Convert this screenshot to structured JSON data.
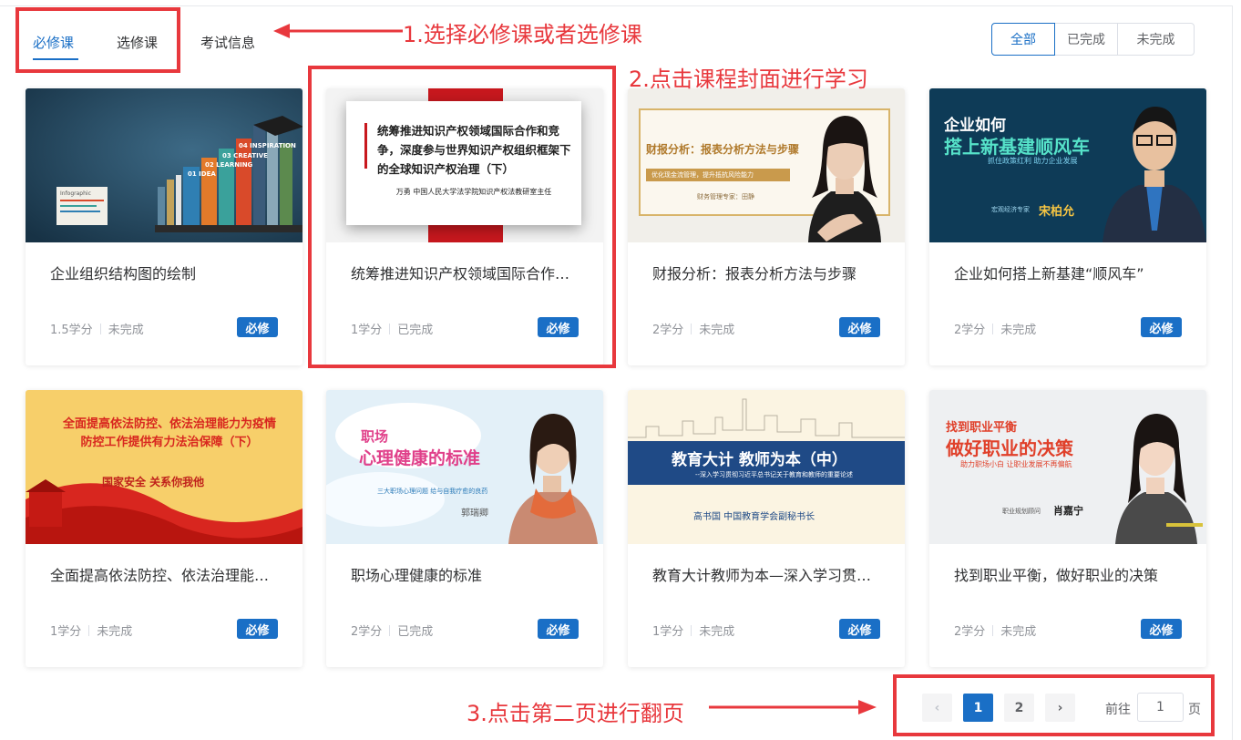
{
  "tabs": [
    {
      "label": "必修课",
      "active": true
    },
    {
      "label": "选修课",
      "active": false
    },
    {
      "label": "考试信息",
      "active": false
    }
  ],
  "filter": [
    {
      "label": "全部",
      "active": true
    },
    {
      "label": "已完成",
      "active": false
    },
    {
      "label": "未完成",
      "active": false
    }
  ],
  "courses": [
    {
      "title": "企业组织结构图的绘制",
      "credit": "1.5学分",
      "status": "未完成",
      "badge": "必修",
      "cover": {
        "book_labels": [
          "01 IDEA",
          "02 LEARNING",
          "03 CREATIVE",
          "04 INSPIRATION"
        ],
        "small_book": "Infographic"
      }
    },
    {
      "title": "统筹推进知识产权领域国际合作…",
      "credit": "1学分",
      "status": "已完成",
      "badge": "必修",
      "cover": {
        "heading": "统筹推进知识产权领域国际合作和竞争，深度参与世界知识产权组织框架下的全球知识产权治理（下）",
        "speaker": "万勇  中国人民大学法学院知识产权法教研室主任"
      }
    },
    {
      "title": "财报分析：报表分析方法与步骤",
      "credit": "2学分",
      "status": "未完成",
      "badge": "必修",
      "cover": {
        "heading": "财报分析：报表分析方法与步骤",
        "sub": "优化现金流管理，提升抵抗风险能力",
        "speaker": "财务管理专家：田静"
      }
    },
    {
      "title": "企业如何搭上新基建“顺风车”",
      "credit": "2学分",
      "status": "未完成",
      "badge": "必修",
      "cover": {
        "line1": "企业如何",
        "line2": "搭上新基建顺风车",
        "sub": "抓住政策红利  助力企业发展",
        "speaker_role": "宏观经济专家",
        "speaker": "宋柏允"
      }
    },
    {
      "title": "全面提高依法防控、依法治理能…",
      "credit": "1学分",
      "status": "未完成",
      "badge": "必修",
      "cover": {
        "heading": "全面提高依法防控、依法治理能力为疫情防控工作提供有力法治保障（下）",
        "sub": "国家安全 关系你我他"
      }
    },
    {
      "title": "职场心理健康的标准",
      "credit": "2学分",
      "status": "已完成",
      "badge": "必修",
      "cover": {
        "line1": "职场",
        "line2": "心理健康的标准",
        "sub": "三大职场心理问题  给与自我疗愈的良药",
        "speaker": "郭瑞卿"
      }
    },
    {
      "title": "教育大计教师为本—深入学习贯…",
      "credit": "1学分",
      "status": "未完成",
      "badge": "必修",
      "cover": {
        "heading": "教育大计  教师为本（中）",
        "sub": "--深入学习贯彻习近平总书记关于教育和教师的重要论述",
        "speaker": "高书国  中国教育学会副秘书长"
      }
    },
    {
      "title": "找到职业平衡，做好职业的决策",
      "credit": "2学分",
      "status": "未完成",
      "badge": "必修",
      "cover": {
        "line1": "找到职业平衡",
        "line2": "做好职业的决策",
        "sub": "助力职场小白  让职业发展不再偏航",
        "speaker_role": "职业规划顾问",
        "speaker": "肖嘉宁"
      }
    }
  ],
  "pagination": {
    "prev": "‹",
    "next": "›",
    "pages": [
      "1",
      "2"
    ],
    "current": 1,
    "goto_label": "前往",
    "goto_value": "1",
    "page_word": "页"
  },
  "annotations": {
    "step1": "1.选择必修课或者选修课",
    "step2": "2.点击课程封面进行学习",
    "step3": "3.点击第二页进行翻页",
    "color": "#e8383d"
  },
  "colors": {
    "accent": "#1a6fc6",
    "annotation": "#e8383d"
  }
}
